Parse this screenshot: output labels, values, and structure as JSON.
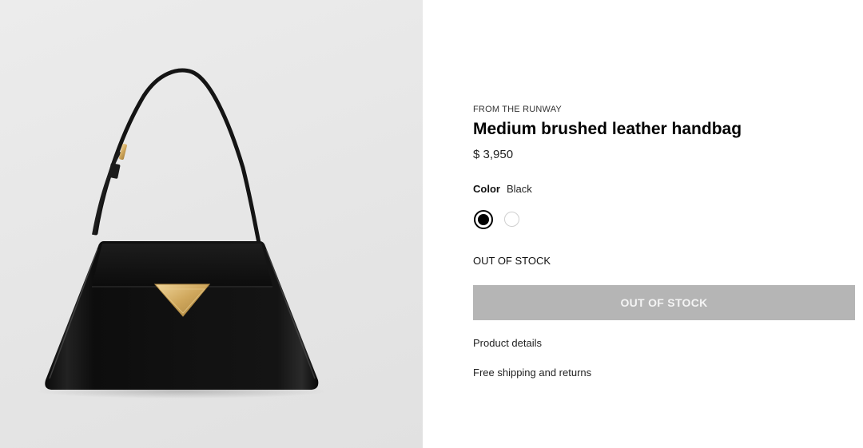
{
  "product": {
    "eyebrow": "FROM THE RUNWAY",
    "title": "Medium brushed leather handbag",
    "price": "$ 3,950"
  },
  "color": {
    "label": "Color",
    "selected": "Black",
    "swatches": [
      {
        "name": "Black",
        "hex": "#000000",
        "selected": true
      },
      {
        "name": "White",
        "hex": "#ffffff",
        "selected": false
      }
    ]
  },
  "availability": {
    "status": "OUT OF STOCK",
    "button_label": "OUT OF STOCK"
  },
  "links": {
    "details": "Product details",
    "shipping": "Free shipping and returns"
  },
  "image": {
    "subject": "black-leather-handbag"
  },
  "colors": {
    "button_disabled": "#b5b5b5",
    "text": "#111111",
    "image_background": "#e6e6e6",
    "hardware_gold": "#d8b36a"
  }
}
